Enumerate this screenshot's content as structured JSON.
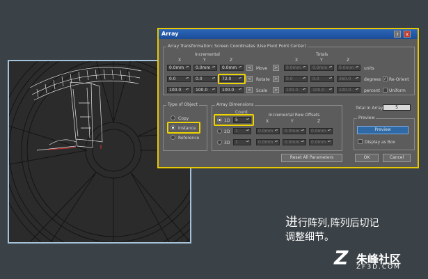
{
  "dialog": {
    "title": "Array",
    "help_button": "?",
    "close_button": "X",
    "transform_group": "Array Transformation: Screen Coordinates (Use Pivot Point Center)",
    "incremental_label": "Incremental",
    "totals_label": "Totals",
    "axes": [
      "X",
      "Y",
      "Z"
    ],
    "rows": [
      {
        "label": "Move",
        "inc": [
          "0.0mm",
          "0.0mm",
          "0.0mm"
        ],
        "tot": [
          "0.0mm",
          "0.0mm",
          "0.0mm"
        ],
        "unit": "units"
      },
      {
        "label": "Rotate",
        "inc": [
          "0.0",
          "0.0",
          "72.0"
        ],
        "tot": [
          "0.0",
          "0.0",
          "360.0"
        ],
        "unit": "degrees"
      },
      {
        "label": "Scale",
        "inc": [
          "100.0",
          "100.0",
          "100.0"
        ],
        "tot": [
          "100.0",
          "100.0",
          "100.0"
        ],
        "unit": "percent"
      }
    ],
    "arrow_left": "<",
    "arrow_right": ">",
    "re_orient": "Re-Orient",
    "uniform": "Uniform",
    "type_group": "Type of Object",
    "type_options": [
      "Copy",
      "Instance",
      "Reference"
    ],
    "dims_group": "Array Dimensions",
    "count_label": "Count",
    "row_offsets_label": "Incremental Row Offsets",
    "dims": [
      {
        "label": "1D",
        "count": "5",
        "offsets": []
      },
      {
        "label": "2D",
        "count": "1",
        "offsets": [
          "0.0mm",
          "0.0mm",
          "0.0mm"
        ]
      },
      {
        "label": "3D",
        "count": "1",
        "offsets": [
          "0.0mm",
          "0.0mm",
          "0.0mm"
        ]
      }
    ],
    "total_label": "Total in Array:",
    "total_value": "5",
    "preview_group": "Preview",
    "preview_button": "Preview",
    "display_as_box": "Display as Box",
    "reset_button": "Reset All Parameters",
    "ok_button": "OK",
    "cancel_button": "Cancel"
  },
  "caption": {
    "first_char": "进",
    "line1": "行阵列,阵列后切记",
    "line2": "调整细节。"
  },
  "logo": {
    "mark": "Z",
    "name": "朱峰社区",
    "domain": "ZF3D.COM"
  },
  "colors": {
    "background": "#3b4247",
    "highlight": "#f0d400",
    "titlebar": "#1b4d99",
    "viewport_border": "#a7c3db"
  }
}
